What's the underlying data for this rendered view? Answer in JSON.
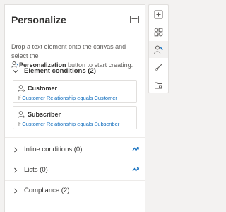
{
  "panel": {
    "title": "Personalize",
    "description_before": "Drop a text element onto the canvas and select the",
    "description_button": "Personalization",
    "description_after": "button to start creating."
  },
  "element_conditions": {
    "label": "Element conditions (2)",
    "items": [
      {
        "name": "Customer",
        "prefix": "If",
        "condition": "Customer Relationship equals Customer"
      },
      {
        "name": "Subscriber",
        "prefix": "If",
        "condition": "Customer Relationship equals Subscriber"
      }
    ]
  },
  "sections": [
    {
      "label": "Inline conditions (0)",
      "icon": "sync-icon"
    },
    {
      "label": "Lists (0)",
      "icon": "sync-icon"
    },
    {
      "label": "Compliance (2)",
      "icon": ""
    }
  ],
  "rail": {
    "items": [
      "add-element-icon",
      "components-icon",
      "personalize-icon",
      "styles-icon",
      "assets-icon"
    ],
    "active": "personalize-icon"
  },
  "colors": {
    "accent": "#0f6cbd",
    "panel_bg": "#ffffff",
    "page_bg": "#f3f2f1"
  }
}
